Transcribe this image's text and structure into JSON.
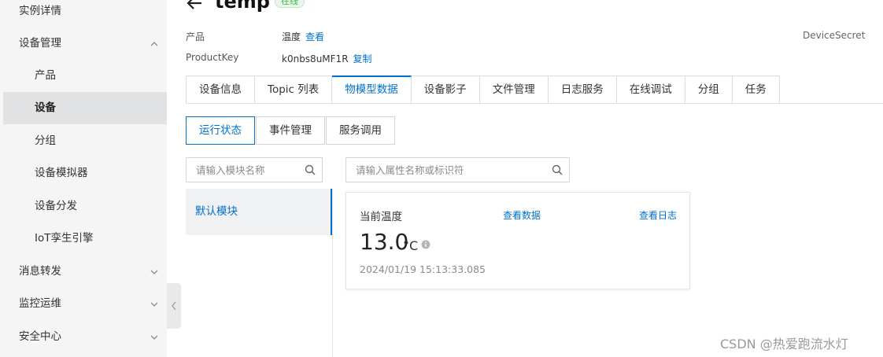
{
  "sidebar": {
    "items": [
      {
        "label": "实例详情",
        "type": "top"
      },
      {
        "label": "设备管理",
        "type": "top",
        "chevron": "up"
      },
      {
        "label": "产品",
        "type": "sub"
      },
      {
        "label": "设备",
        "type": "sub",
        "active": true
      },
      {
        "label": "分组",
        "type": "sub"
      },
      {
        "label": "设备模拟器",
        "type": "sub"
      },
      {
        "label": "设备分发",
        "type": "sub"
      },
      {
        "label": "IoT孪生引擎",
        "type": "sub"
      },
      {
        "label": "消息转发",
        "type": "top",
        "chevron": "down"
      },
      {
        "label": "监控运维",
        "type": "top",
        "chevron": "down"
      },
      {
        "label": "安全中心",
        "type": "top",
        "chevron": "down"
      }
    ]
  },
  "header": {
    "title": "temp",
    "status": "在线",
    "product_label": "产品",
    "product_value": "温度",
    "product_link": "查看",
    "productkey_label": "ProductKey",
    "productkey_value": "k0nbs8uMF1R",
    "productkey_link": "复制",
    "devicesecret_label": "DeviceSecret"
  },
  "tabs": [
    {
      "label": "设备信息"
    },
    {
      "label": "Topic 列表"
    },
    {
      "label": "物模型数据",
      "active": true
    },
    {
      "label": "设备影子"
    },
    {
      "label": "文件管理"
    },
    {
      "label": "日志服务"
    },
    {
      "label": "在线调试"
    },
    {
      "label": "分组"
    },
    {
      "label": "任务"
    }
  ],
  "subtabs": [
    {
      "label": "运行状态",
      "active": true
    },
    {
      "label": "事件管理"
    },
    {
      "label": "服务调用"
    }
  ],
  "module_search": {
    "placeholder": "请输入模块名称"
  },
  "property_search": {
    "placeholder": "请输入属性名称或标识符"
  },
  "modules": [
    {
      "label": "默认模块",
      "active": true
    }
  ],
  "card": {
    "title": "当前温度",
    "link_data": "查看数据",
    "link_log": "查看日志",
    "value": "13.0",
    "unit": "°C",
    "timestamp": "2024/01/19 15:13:33.085"
  },
  "watermark": "CSDN @热爱跑流水灯",
  "colors": {
    "accent": "#0070cc",
    "status_green": "#3bb44a",
    "sidebar_bg": "#f5f5f6"
  }
}
